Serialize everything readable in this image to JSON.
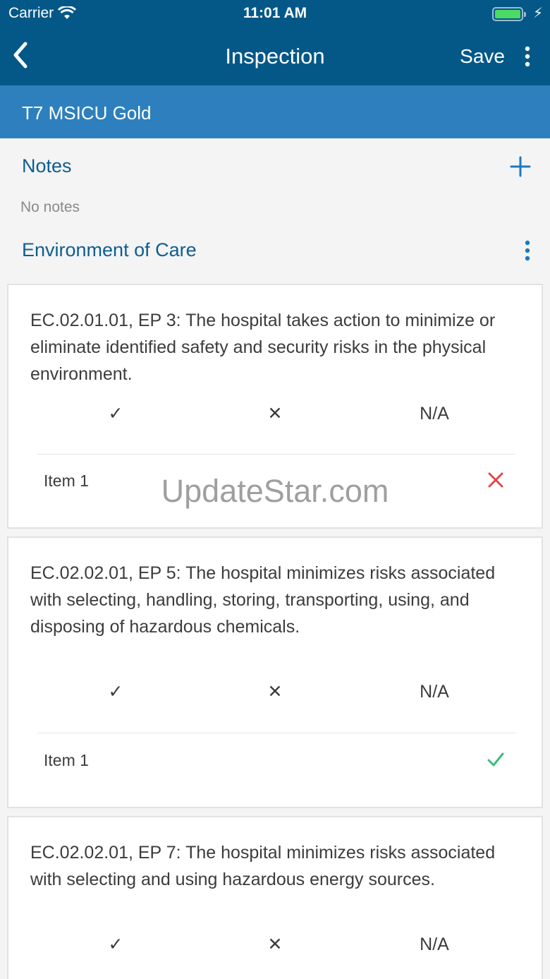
{
  "status_bar": {
    "carrier": "Carrier",
    "time": "11:01 AM"
  },
  "nav": {
    "title": "Inspection",
    "save_label": "Save"
  },
  "location": "T7 MSICU Gold",
  "notes": {
    "title": "Notes",
    "empty_text": "No notes"
  },
  "section": {
    "title": "Environment of Care"
  },
  "options": {
    "yes_symbol": "✓",
    "no_symbol": "✕",
    "na_label": "N/A"
  },
  "cards": [
    {
      "question": "EC.02.01.01, EP 3: The hospital takes action to minimize or eliminate identified safety and security risks in the physical environment.",
      "item_label": "Item 1",
      "item_status": "fail"
    },
    {
      "question": "EC.02.02.01, EP 5: The hospital minimizes risks associated with selecting, handling, storing, transporting, using, and disposing of hazardous chemicals.",
      "item_label": "Item 1",
      "item_status": "pass"
    },
    {
      "question": "EC.02.02.01, EP 7: The hospital minimizes risks associated with selecting and using hazardous energy sources."
    }
  ],
  "watermark": "UpdateStar.com",
  "colors": {
    "header": "#045888",
    "subheader": "#2d80bd",
    "accent": "#0e5e8f",
    "fail": "#e0474c",
    "pass": "#3cbf7a"
  },
  "icons": {
    "back": "chevron-left-icon",
    "more": "more-vertical-icon",
    "add": "plus-icon",
    "wifi": "wifi-icon",
    "battery": "battery-icon"
  }
}
